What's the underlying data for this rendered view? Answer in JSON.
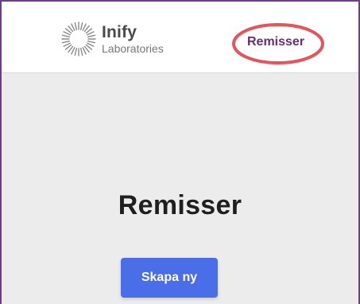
{
  "brand": {
    "name": "Inify",
    "subtitle": "Laboratories",
    "logo_icon": "sunburst-ring-icon"
  },
  "nav": {
    "remisser_label": "Remisser",
    "annotation_color": "#e5545a"
  },
  "main": {
    "title": "Remisser",
    "create_button_label": "Skapa ny"
  },
  "colors": {
    "frame": "#6f3b8c",
    "nav_link": "#6b2d75",
    "button": "#4a6ee8",
    "background": "#ececec"
  }
}
